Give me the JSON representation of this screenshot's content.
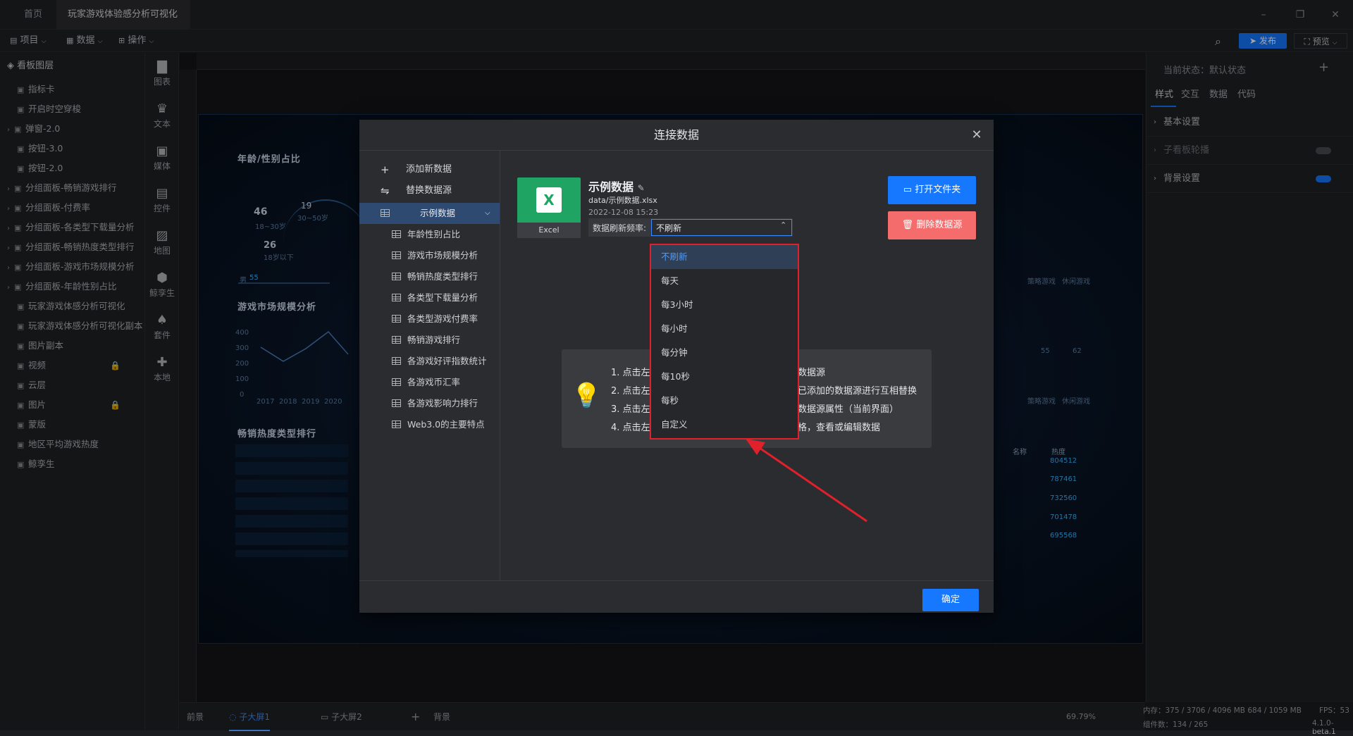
{
  "titlebar": {
    "tabs": [
      "首页",
      "玩家游戏体验感分析可视化"
    ],
    "close_glyph": "×"
  },
  "menubar": {
    "items": [
      "项目",
      "数据",
      "操作"
    ],
    "publish": "发布",
    "preview": "预览"
  },
  "layers": {
    "header": "看板图层",
    "items": [
      {
        "label": "指标卡",
        "lock": false
      },
      {
        "label": "开启时空穿梭",
        "lock": false
      },
      {
        "label": "弹窗-2.0",
        "lock": false
      },
      {
        "label": "按钮-3.0",
        "lock": false
      },
      {
        "label": "按钮-2.0",
        "lock": false
      },
      {
        "label": "分组面板-畅销游戏排行",
        "lock": false
      },
      {
        "label": "分组面板-付费率",
        "lock": false
      },
      {
        "label": "分组面板-各类型下载量分析",
        "lock": false
      },
      {
        "label": "分组面板-畅销热度类型排行",
        "lock": false
      },
      {
        "label": "分组面板-游戏市场规模分析",
        "lock": false
      },
      {
        "label": "分组面板-年龄性别占比",
        "lock": false
      },
      {
        "label": "玩家游戏体感分析可视化",
        "lock": false
      },
      {
        "label": "玩家游戏体感分析可视化副本",
        "lock": false
      },
      {
        "label": "图片副本",
        "lock": false
      },
      {
        "label": "视频",
        "lock": true
      },
      {
        "label": "云层",
        "lock": false
      },
      {
        "label": "图片",
        "lock": true
      },
      {
        "label": "蒙版",
        "lock": false
      },
      {
        "label": "地区平均游戏热度",
        "lock": false
      },
      {
        "label": "鲸孪生",
        "lock": false
      }
    ]
  },
  "tools": [
    "图表",
    "文本",
    "媒体",
    "控件",
    "地图",
    "鲸孪生",
    "套件",
    "本地"
  ],
  "screen": {
    "panel1": "年龄/性别占比",
    "panel2": "游戏市场规模分析",
    "panel3": "畅销热度类型排行",
    "age_labels": [
      "19",
      "46",
      "30~50岁",
      "18~30岁",
      "26",
      "18岁以下",
      "男",
      "55"
    ],
    "years": [
      "2017",
      "2018",
      "2019",
      "2020"
    ],
    "y_ticks": [
      "400",
      "300",
      "200",
      "100",
      "0"
    ],
    "heat_header": [
      "名称",
      "热度"
    ],
    "heat_values": [
      "804512",
      "787461",
      "732560",
      "701478",
      "695568"
    ],
    "peak_values": [
      "55",
      "62"
    ],
    "cat_labels": [
      "策略游戏",
      "休闲游戏"
    ]
  },
  "props": {
    "state": "当前状态：默认状态",
    "tabs": [
      "样式",
      "交互",
      "数据",
      "代码"
    ],
    "sections": [
      "基本设置",
      "子看板轮播",
      "背景设置"
    ]
  },
  "bottombar": {
    "front": "前景",
    "screen1": "子大屏1",
    "screen2": "子大屏2",
    "back": "背景",
    "zoom": "69.79%",
    "memory": "内存：375 / 3706 / 4096 MB   684 / 1059 MB",
    "components": "组件数：134 / 265",
    "fps": "FPS：53",
    "version": "4.1.0-beta.1"
  },
  "dialog": {
    "title": "连接数据",
    "actions": [
      "添加新数据",
      "替换数据源"
    ],
    "selected_source": "示例数据",
    "sources": [
      "年龄性别占比",
      "游戏市场规模分析",
      "畅销热度类型排行",
      "各类型下载量分析",
      "各类型游戏付费率",
      "畅销游戏排行",
      "各游戏好评指数统计",
      "各游戏币汇率",
      "各游戏影响力排行",
      "Web3.0的主要特点"
    ],
    "file": {
      "name": "示例数据",
      "path": "data/示例数据.xlsx",
      "date": "2022-12-08 15:23",
      "type": "Excel"
    },
    "refresh_label": "数据刷新频率:",
    "refresh_value": "不刷新",
    "open_folder": "打开文件夹",
    "delete_source": "删除数据源",
    "confirm": "确定",
    "tips": [
      "1. 点击左侧",
      "2. 点击左侧",
      "3. 点击左侧",
      "4. 点击左侧"
    ],
    "tips_right": [
      "数据源",
      "已添加的数据源进行互相替换",
      "数据源属性（当前界面）",
      "格，查看或编辑数据"
    ]
  },
  "dropdown": {
    "options": [
      "不刷新",
      "每天",
      "每3小时",
      "每小时",
      "每分钟",
      "每10秒",
      "每秒",
      "自定义"
    ],
    "selected_index": 0
  },
  "colors": {
    "accent": "#1677ff",
    "danger": "#f56c6c",
    "highlight": "#e0202a",
    "excel": "#1fa463"
  }
}
